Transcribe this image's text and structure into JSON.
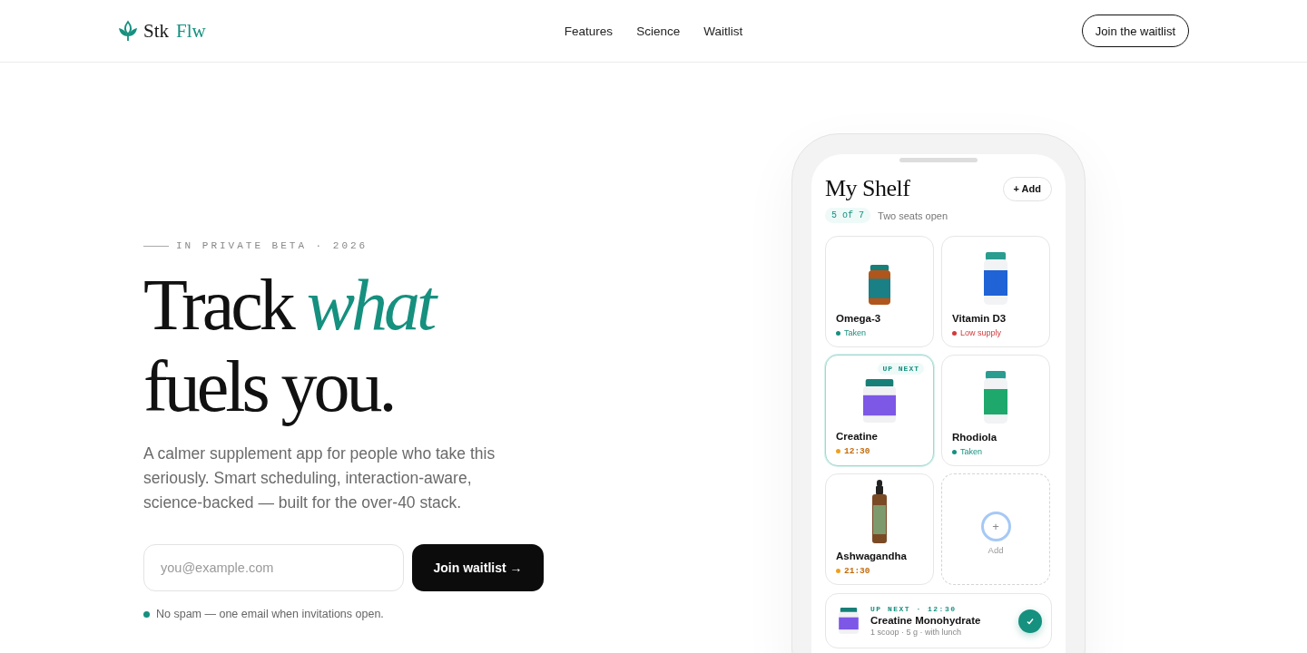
{
  "header": {
    "logo": {
      "part_1": "Stk",
      "part_2": "Flw"
    },
    "nav": [
      "Features",
      "Science",
      "Waitlist"
    ],
    "cta": "Join the waitlist"
  },
  "hero": {
    "eyebrow": "IN PRIVATE BETA · 2026",
    "headline_lines": [
      "Track *what*",
      "fuels you."
    ],
    "description": "A calmer supplement app for people who take this seriously. Smart scheduling, interaction-aware, science-backed — built for the over-40 stack.",
    "email": {
      "placeholder": "you@example.com"
    },
    "submit": "Join waitlist →",
    "note": "No spam — one email when invitations open."
  },
  "phone": {
    "title": "My Shelf",
    "add_button": "+ Add",
    "count": "5 of 7",
    "count_note": "Two seats open",
    "supplements": [
      {
        "name": "Omega-3",
        "kind": "amber-bottle",
        "status": {
          "kind": "state",
          "text": "Taken"
        },
        "color": "#16907f",
        "selected": false
      },
      {
        "name": "Vitamin D3",
        "kind": "blue-bottle",
        "status": {
          "kind": "state",
          "text": "Low supply"
        },
        "color": "#d23a3a",
        "selected": false
      },
      {
        "name": "Creatine",
        "kind": "purple-jar",
        "status": {
          "kind": "time",
          "text": "12:30"
        },
        "color": "#f0a020",
        "selected": true,
        "badge": "UP NEXT"
      },
      {
        "name": "Rhodiola",
        "kind": "green-bottle",
        "status": {
          "kind": "state",
          "text": "Taken"
        },
        "color": "#16907f",
        "selected": false
      },
      {
        "name": "Ashwagandha",
        "kind": "dropper",
        "status": {
          "kind": "time",
          "text": "21:30"
        },
        "color": "#f0a020",
        "selected": false
      }
    ],
    "add_tile": {
      "label": "Add",
      "icon": "+"
    },
    "up_next": {
      "eyebrow": "UP NEXT · 12:30",
      "name": "Creatine Monohydrate",
      "detail": "1 scoop · 5 g · with lunch",
      "done": true
    }
  }
}
